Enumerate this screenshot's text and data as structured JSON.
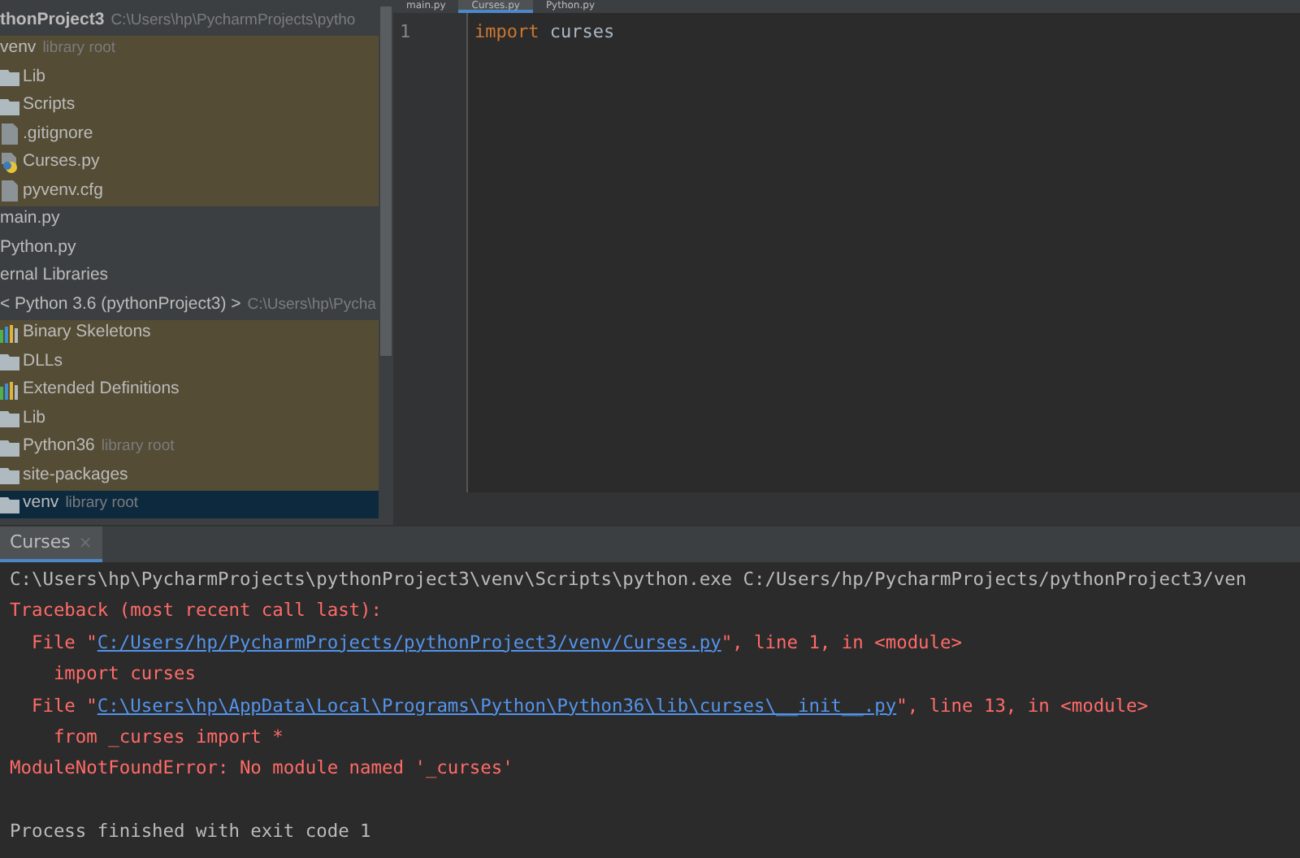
{
  "project_tree": {
    "items": [
      {
        "label": "thonProject3",
        "kind": "project",
        "hint": "C:\\Users\\hp\\PycharmProjects\\pytho",
        "children": [
          {
            "label": "venv",
            "hint": "library root",
            "highlighted": true,
            "selected": false,
            "children": [
              {
                "label": "Lib",
                "kind": "folder",
                "highlighted": true,
                "selected": false
              },
              {
                "label": "Scripts",
                "kind": "folder",
                "highlighted": true,
                "selected": false
              },
              {
                "label": ".gitignore",
                "kind": "file",
                "highlighted": true,
                "selected": false
              },
              {
                "label": "Curses.py",
                "kind": "python",
                "highlighted": true,
                "selected": false
              },
              {
                "label": "pyvenv.cfg",
                "kind": "file",
                "highlighted": true,
                "selected": false
              }
            ]
          },
          {
            "label": "main.py",
            "highlighted": false,
            "selected": false
          },
          {
            "label": "Python.py",
            "highlighted": false,
            "selected": false
          }
        ]
      },
      {
        "label": "ernal Libraries",
        "children": [
          {
            "label": "< Python 3.6 (pythonProject3) >",
            "hint": "C:\\Users\\hp\\Pycha",
            "highlighted": false,
            "selected": false,
            "children": [
              {
                "label": "Binary Skeletons",
                "kind": "lib",
                "highlighted": true,
                "selected": false
              },
              {
                "label": "DLLs",
                "kind": "folder",
                "highlighted": true,
                "selected": false
              },
              {
                "label": "Extended Definitions",
                "kind": "lib",
                "highlighted": true,
                "selected": false
              },
              {
                "label": "Lib",
                "kind": "folder",
                "highlighted": true,
                "selected": false
              },
              {
                "label": "Python36",
                "kind": "folder",
                "hint": "library root",
                "highlighted": true,
                "selected": false
              },
              {
                "label": "site-packages",
                "kind": "folder",
                "highlighted": true,
                "selected": false
              },
              {
                "label": "venv",
                "kind": "folder",
                "hint": "library root",
                "highlighted": true,
                "selected": true
              }
            ]
          }
        ]
      }
    ]
  },
  "editor": {
    "tabs": [
      {
        "label": "main.py",
        "selected": false
      },
      {
        "label": "Curses.py",
        "selected": true
      },
      {
        "label": "Python.py",
        "selected": false
      }
    ],
    "lines": [
      {
        "number": "1",
        "keyword": "import",
        "rest": " curses"
      }
    ]
  },
  "run_panel": {
    "tab": {
      "label": "Curses",
      "close": "×",
      "selected": true
    },
    "lines": [
      {
        "kind": "plain",
        "text": "C:\\Users\\hp\\PycharmProjects\\pythonProject3\\venv\\Scripts\\python.exe C:/Users/hp/PycharmProjects/pythonProject3/ven"
      },
      {
        "kind": "error",
        "text": "Traceback (most recent call last):"
      },
      {
        "kind": "link",
        "before": "  File \"",
        "link": "C:/Users/hp/PycharmProjects/pythonProject3/venv/Curses.py",
        "after": "\", line 1, in <module>"
      },
      {
        "kind": "error",
        "text": "    import curses"
      },
      {
        "kind": "link",
        "before": "  File \"",
        "link": "C:\\Users\\hp\\AppData\\Local\\Programs\\Python\\Python36\\lib\\curses\\__init__.py",
        "after": "\", line 13, in <module>"
      },
      {
        "kind": "error",
        "text": "    from _curses import *"
      },
      {
        "kind": "error",
        "text": "ModuleNotFoundError: No module named '_curses'"
      },
      {
        "kind": "blank"
      },
      {
        "kind": "plain",
        "text": "Process finished with exit code 1"
      }
    ]
  }
}
